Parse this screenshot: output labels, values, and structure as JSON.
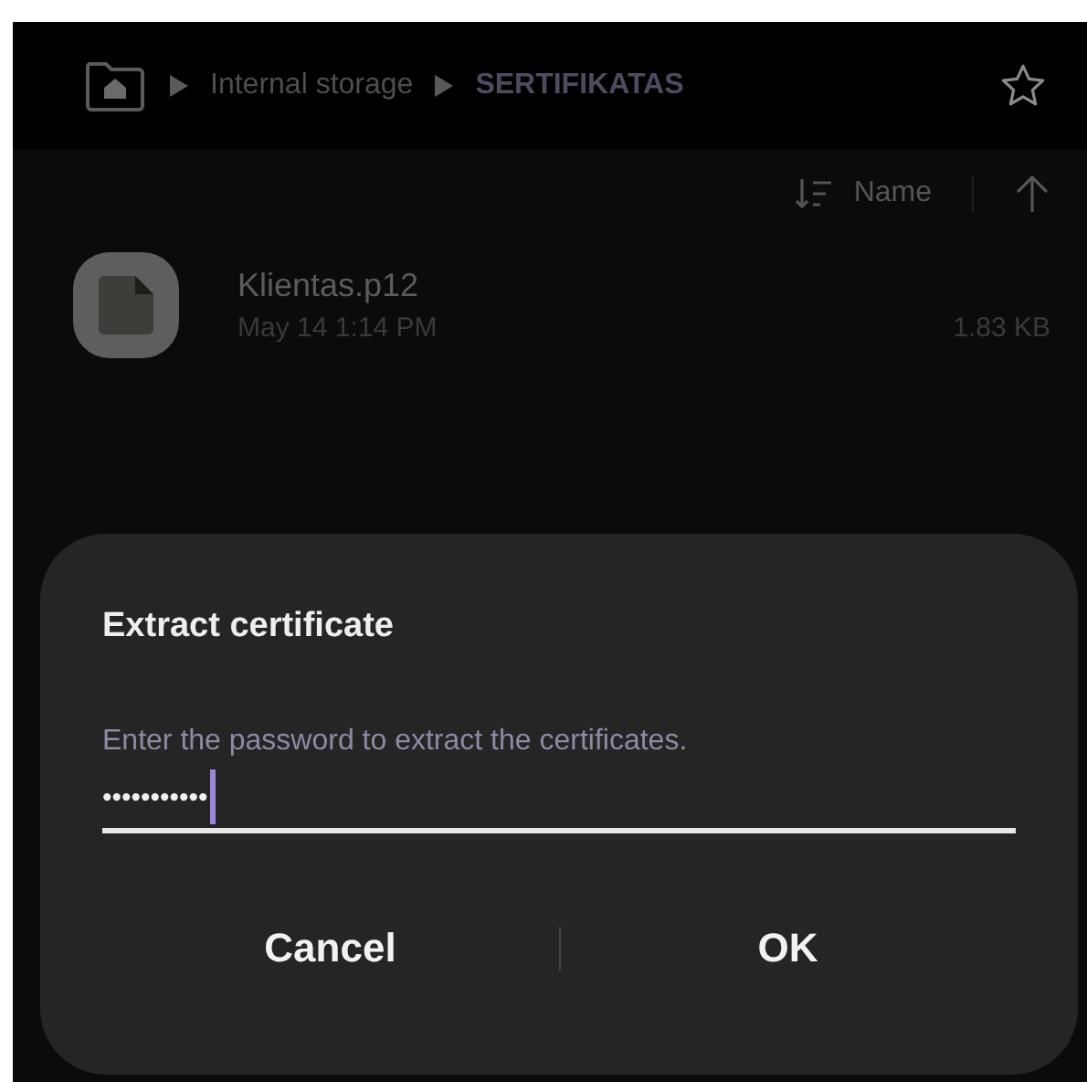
{
  "breadcrumb": [
    {
      "label": "Internal storage",
      "current": false
    },
    {
      "label": "SERTIFIKATAS",
      "current": true
    }
  ],
  "sort": {
    "label": "Name"
  },
  "files": [
    {
      "name": "Klientas.p12",
      "date": "May 14 1:14 PM",
      "size": "1.83 KB"
    }
  ],
  "dialog": {
    "title": "Extract certificate",
    "hint": "Enter the password to extract the certificates.",
    "value": "•••••••••••",
    "buttons": [
      "Cancel",
      "OK"
    ]
  }
}
